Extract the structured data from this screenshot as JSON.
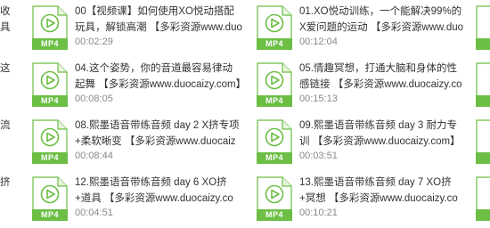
{
  "left_partial": [
    "收",
    "具",
    "这",
    "",
    "流",
    "",
    "挤",
    ""
  ],
  "files": [
    {
      "name": "00【视频课】如何使用XO悦动搭配玩具，解锁高潮 【多彩资源www.duocaizy.com】",
      "duration": "00:02:29",
      "type": "MP4"
    },
    {
      "name": "01.XO悦动训练，一个能解决99%的X爱问题的运动 【多彩资源www.duocaizy.com】",
      "duration": "00:12:04",
      "type": "MP4"
    },
    {
      "name": "04.这个姿势，你的音道最容易律动起舞 【多彩资源www.duocaizy.com】",
      "duration": "00:08:05",
      "type": "MP4"
    },
    {
      "name": "05.情趣冥想，打通大脑和身体的性感链接 【多彩资源www.duocaizy.com】",
      "duration": "00:15:13",
      "type": "MP4"
    },
    {
      "name": "08.熙墨语音带练音频 day 2 X挤专项+柔软晰变 【多彩资源www.duocaizy.com】",
      "duration": "00:08:44",
      "type": "MP4"
    },
    {
      "name": "09.熙墨语音带练音频 day 3 耐力专训 【多彩资源www.duocaizy.com】",
      "duration": "00:03:51",
      "type": "MP4"
    },
    {
      "name": "12.熙墨语音带练音频 day 6 XO挤+道具 【多彩资源www.duocaizy.com】",
      "duration": "00:04:51",
      "type": "MP4"
    },
    {
      "name": "13.熙墨语音带练音频 day 7 XO挤+冥想 【多彩资源www.duocaizy.com】",
      "duration": "00:10:21",
      "type": "MP4"
    }
  ],
  "colors": {
    "badge": "#6cbe45",
    "icon_outline": "#6cbe45",
    "duration": "#888888"
  }
}
